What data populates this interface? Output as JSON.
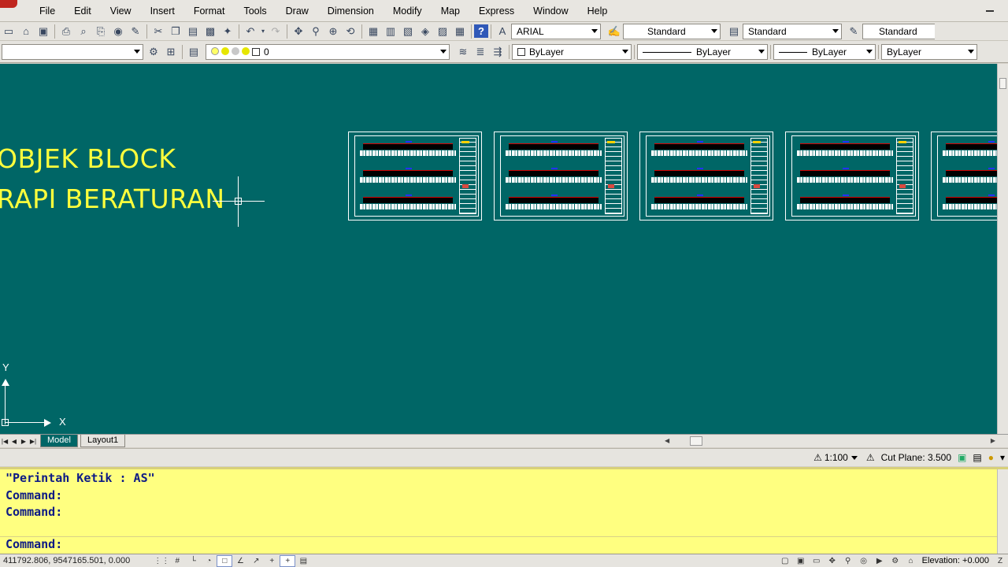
{
  "menu": [
    "File",
    "Edit",
    "View",
    "Insert",
    "Format",
    "Tools",
    "Draw",
    "Dimension",
    "Modify",
    "Map",
    "Express",
    "Window",
    "Help"
  ],
  "toolbar1": {
    "text_style": "ARIAL",
    "dim_style": "Standard",
    "table_style": "Standard",
    "mleader_style": "Standard"
  },
  "toolbar2": {
    "workspace": "",
    "layer": "0",
    "color": "ByLayer",
    "linetype": "ByLayer",
    "lineweight": "ByLayer",
    "plotstyle": "ByLayer"
  },
  "canvas": {
    "text_line1": "OBJEK BLOCK",
    "text_line2": "RAPI BERATURAN",
    "ucs_x": "X",
    "ucs_y": "Y"
  },
  "tabs": [
    "Model",
    "Layout1"
  ],
  "annotation": {
    "scale": "1:100",
    "cut_plane": "Cut Plane: 3.500"
  },
  "command": {
    "line1": "\"Perintah Ketik : AS\"",
    "line2": "Command:",
    "line3": "Command:",
    "prompt": "Command:"
  },
  "status": {
    "coordinates": "411792.806, 9547165.501, 0.000",
    "elevation": "Elevation: +0.000"
  },
  "colors": {
    "canvas_bg": "#006666",
    "canvas_text": "#ffff3c",
    "command_bg": "#ffff80",
    "command_text": "#0d1a85"
  }
}
